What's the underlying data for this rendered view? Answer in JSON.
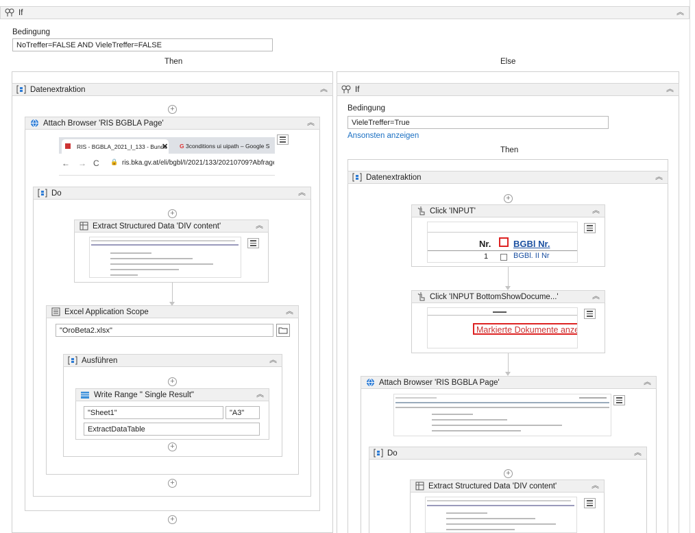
{
  "outer_if": {
    "title": "If",
    "condition_label": "Bedingung",
    "condition": "NoTreffer=FALSE AND VieleTreffer=FALSE",
    "then_label": "Then",
    "else_label": "Else"
  },
  "left": {
    "seq_title": "Datenextraktion",
    "attach_title": "Attach Browser 'RIS BGBLA Page'",
    "browser": {
      "tab1": "RIS - BGBLA_2021_I_133 - Bunde",
      "tab2": "3conditions ui uipath – Google S",
      "url": "ris.bka.gv.at/eli/bgbl/I/2021/133/20210709?Abfrage"
    },
    "do_title": "Do",
    "extract_title": "Extract Structured Data 'DIV  content'",
    "excel_title": "Excel Application Scope",
    "excel_file": "\"OroBeta2.xlsx\"",
    "ausfuehren_title": "Ausführen",
    "write_title": "Write Range \" Single Result\"",
    "sheet": "\"Sheet1\"",
    "cell": "\"A3\"",
    "table": "ExtractDataTable"
  },
  "right": {
    "if_title": "If",
    "condition_label": "Bedingung",
    "condition": "VieleTreffer=True",
    "else_link": "Ansonsten anzeigen",
    "then_label": "Then",
    "seq_title": "Datenextraktion",
    "click1_title": "Click 'INPUT'",
    "click1_preview": {
      "nr": "Nr.",
      "bgbl": "BGBl Nr.",
      "row_num": "1",
      "row_text": "BGBl. II Nr"
    },
    "click2_title": "Click 'INPUT  BottomShowDocume...'",
    "click2_preview": "Markierte Dokumente anze",
    "attach_title": "Attach Browser 'RIS BGBLA Page'",
    "do_title": "Do",
    "extract_title": "Extract Structured Data 'DIV  content'"
  }
}
